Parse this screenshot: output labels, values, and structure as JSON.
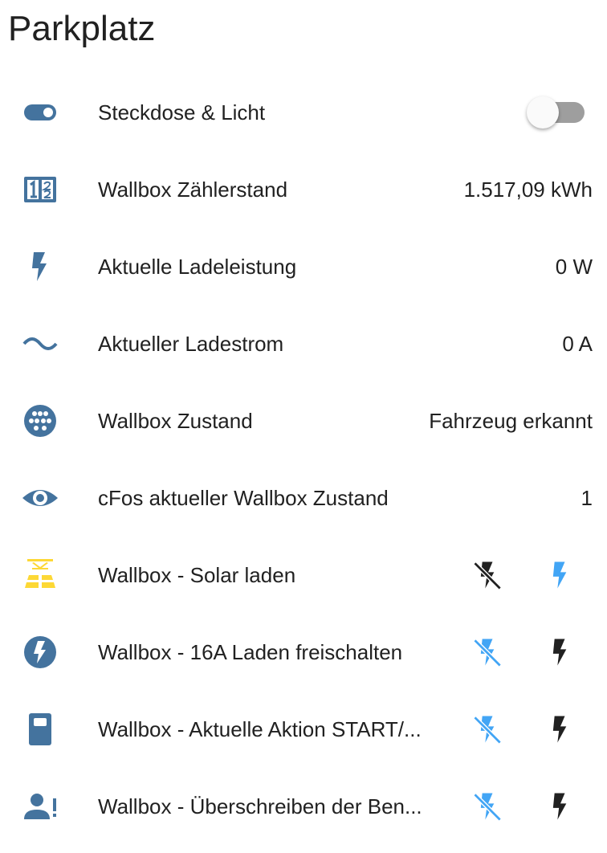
{
  "card": {
    "title": "Parkplatz"
  },
  "colors": {
    "icon": "#44739e",
    "active": "#ffc107",
    "solar": "#fdd835",
    "button_blue": "#42a5f5",
    "button_dark": "#212121",
    "text": "#212121"
  },
  "rows": [
    {
      "name": "Steckdose & Licht",
      "icon": "toggle-switch-icon",
      "control": "toggle",
      "state": "off"
    },
    {
      "name": "Wallbox Zählerstand",
      "icon": "counter-icon",
      "value": "1.517,09 kWh"
    },
    {
      "name": "Aktuelle Ladeleistung",
      "icon": "flash-icon",
      "value": "0 W"
    },
    {
      "name": "Aktueller Ladestrom",
      "icon": "current-ac-icon",
      "value": "0 A"
    },
    {
      "name": "Wallbox Zustand",
      "icon": "ev-plug-type2-icon",
      "value": "Fahrzeug erkannt"
    },
    {
      "name": "cFos aktueller Wallbox Zustand",
      "icon": "eye-icon",
      "value": "1"
    },
    {
      "name": "Wallbox - Solar laden",
      "icon": "solar-power-icon",
      "control": "buttons",
      "state": "on"
    },
    {
      "name": "Wallbox - 16A Laden freischalten",
      "icon": "flash-circle-icon",
      "control": "buttons",
      "state": "off"
    },
    {
      "name": "Wallbox - Aktuelle Aktion START/...",
      "icon": "ev-station-icon",
      "control": "buttons",
      "state": "off"
    },
    {
      "name": "Wallbox - Überschreiben der Ben...",
      "icon": "account-alert-icon",
      "control": "buttons",
      "state": "off"
    }
  ]
}
